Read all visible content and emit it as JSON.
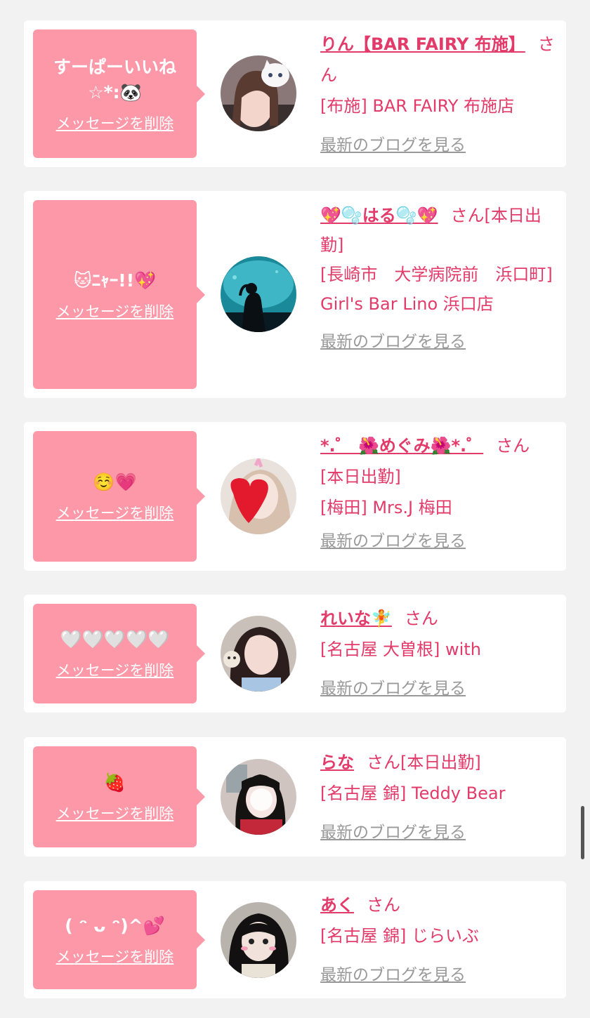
{
  "cards": [
    {
      "message": "すーぱーいいね☆*:🐼",
      "delete_label": "メッセージを削除",
      "name": "りん【BAR FAIRY 布施】",
      "honorific": "さん",
      "status": "",
      "shop": "[布施] BAR FAIRY 布施店",
      "blog_label": "最新のブログを見る"
    },
    {
      "message": "🐱ﾆｬｰ!!💖",
      "delete_label": "メッセージを削除",
      "name": "💖🫧はる🫧💖",
      "honorific": "さん",
      "status": "[本日出勤]",
      "shop": "[長崎市　大学病院前　浜口町] Girl's Bar Lino 浜口店",
      "blog_label": "最新のブログを見る"
    },
    {
      "message": "☺️💗",
      "delete_label": "メッセージを削除",
      "name": "*.゜ 🌺めぐみ🌺*.゜",
      "honorific": "さん",
      "status": "[本日出勤]",
      "shop": "[梅田] Mrs.J 梅田",
      "blog_label": "最新のブログを見る"
    },
    {
      "message": "🤍🤍🤍🤍🤍",
      "delete_label": "メッセージを削除",
      "name": "れいな🧚",
      "honorific": "さん",
      "status": "",
      "shop": "[名古屋 大曽根] with",
      "blog_label": "最新のブログを見る"
    },
    {
      "message": "🍓",
      "delete_label": "メッセージを削除",
      "name": "らな",
      "honorific": "さん",
      "status": "[本日出勤]",
      "shop": "[名古屋 錦] Teddy Bear",
      "blog_label": "最新のブログを見る"
    },
    {
      "message": "( ᵔ ᴗ ᵔ)^💕",
      "delete_label": "メッセージを削除",
      "name": "あく",
      "honorific": "さん",
      "status": "",
      "shop": "[名古屋 錦] じらいぶ",
      "blog_label": "最新のブログを見る"
    }
  ],
  "colors": {
    "bubble": "#fd98a8",
    "accent": "#e23b6a",
    "muted": "#999999",
    "background": "#f2f2f2"
  }
}
